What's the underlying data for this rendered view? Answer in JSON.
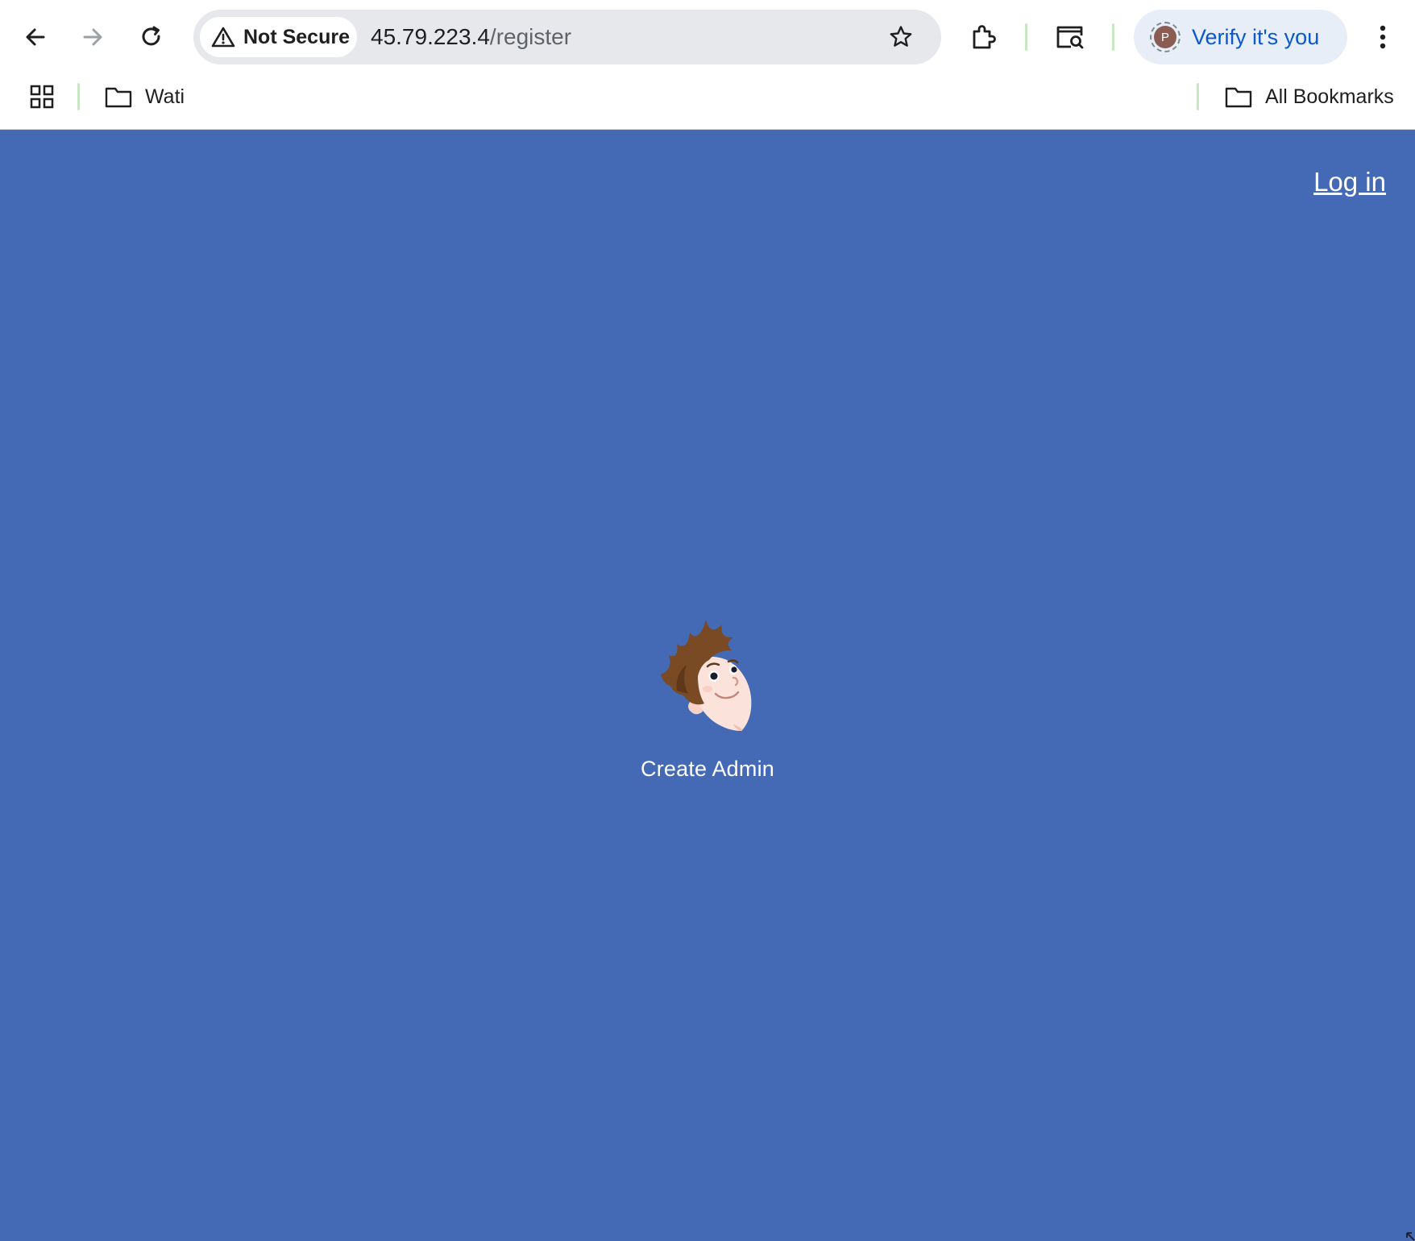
{
  "browser": {
    "security_label": "Not Secure",
    "url_host": "45.79.223.4",
    "url_path": "/register",
    "profile_initial": "P",
    "verify_label": "Verify it's you",
    "bookmarks_bar": {
      "folder_label": "Wati",
      "all_bookmarks_label": "All Bookmarks"
    },
    "icons": [
      "back-arrow-icon",
      "forward-arrow-icon",
      "reload-icon",
      "warning-triangle-icon",
      "star-icon",
      "extensions-puzzle-icon",
      "tab-search-icon",
      "kebab-menu-icon",
      "apps-grid-icon",
      "folder-icon"
    ]
  },
  "page": {
    "login_link": "Log in",
    "hero_title": "Create Admin",
    "background_color": "#4469b5",
    "text_color": "#ffffff"
  }
}
